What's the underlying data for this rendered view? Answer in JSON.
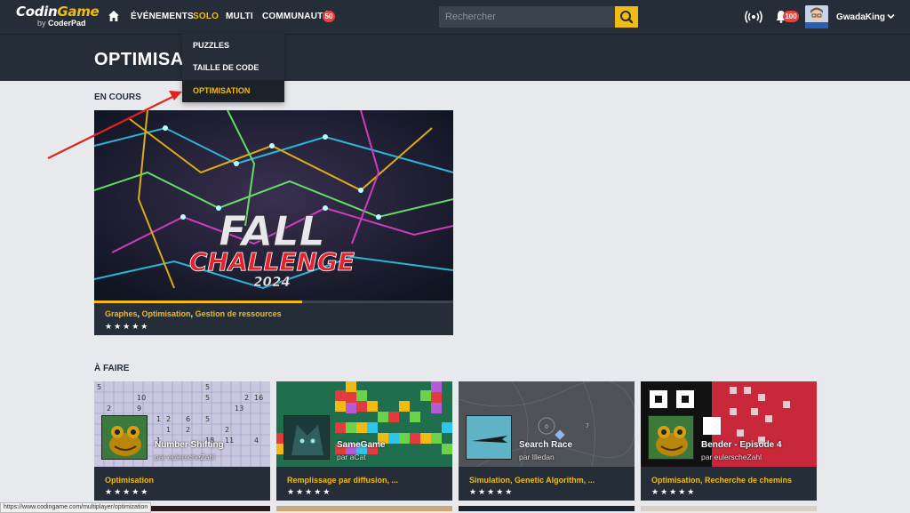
{
  "header": {
    "logo_main_a": "Codin",
    "logo_main_b": "Game",
    "logo_by": "by",
    "logo_sub": "CoderPad",
    "nav": [
      {
        "label": "ÉVÉNEMENTS",
        "active": false
      },
      {
        "label": "SOLO",
        "active": true
      },
      {
        "label": "MULTI",
        "active": false
      },
      {
        "label": "COMMUNAUTÉ",
        "active": false
      }
    ],
    "community_badge": "50",
    "search_placeholder": "Rechercher",
    "notif_badge": "100",
    "username": "GwadaKing"
  },
  "dropdown": {
    "items": [
      {
        "label": "PUZZLES",
        "active": false
      },
      {
        "label": "TAILLE DE CODE",
        "active": false
      },
      {
        "label": "OPTIMISATION",
        "active": true
      }
    ]
  },
  "page": {
    "title": "OPTIMISA",
    "section_current": "EN COURS",
    "section_todo": "À FAIRE"
  },
  "featured": {
    "title_line1": "FALL",
    "title_line2": "CHALLENGE",
    "title_line3": "2024",
    "tags": [
      "Graphes",
      "Optimisation",
      "Gestion de ressources"
    ],
    "stars": "★★★★★",
    "progress": 0.58
  },
  "cards": [
    {
      "title": "Number Shifting",
      "author": "par eulerscheZahl",
      "tags": "Optimisation",
      "tags_more": "",
      "stars": "★★★★★"
    },
    {
      "title": "SameGame",
      "author": "par aCat",
      "tags": "Remplissage par diffusion, ...",
      "tags_more": "",
      "stars": "★★★★★"
    },
    {
      "title": "Search Race",
      "author": "par Illedan",
      "tags": "Simulation, Genetic Algorithm, ...",
      "tags_more": "",
      "stars": "★★★★★"
    },
    {
      "title": "Bender - Episode 4",
      "author": "par eulerscheZahl",
      "tags": "Optimisation, Recherche de chemins",
      "tags_more": "",
      "stars": "★★★★★"
    }
  ],
  "status_bar": "https://www.codingame.com/multiplayer/optimization",
  "colors": {
    "accent": "#f2bb13",
    "nav_bg": "#252e38",
    "page_bg": "#e8e9ec",
    "badge": "#e7423c",
    "arrow": "#e0231c"
  }
}
